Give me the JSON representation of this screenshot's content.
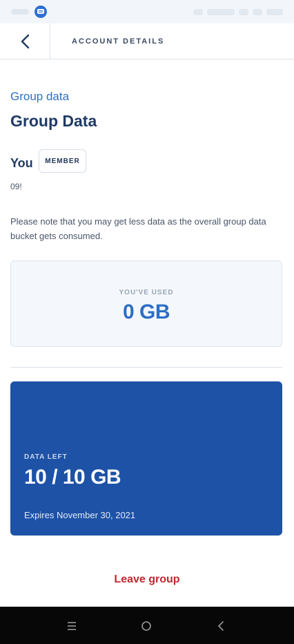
{
  "header": {
    "title": "ACCOUNT DETAILS"
  },
  "main": {
    "section_label": "Group data",
    "title": "Group Data",
    "you_label": "You",
    "member_badge": "MEMBER",
    "phone_number": "09!",
    "note": "Please note that you may get less data as the overall group data bucket gets consumed.",
    "used": {
      "label": "YOU'VE USED",
      "value": "0 GB"
    },
    "left": {
      "label": "DATA LEFT",
      "value": "10 / 10 GB",
      "expires": "Expires November 30, 2021"
    },
    "leave_group": "Leave group"
  },
  "colors": {
    "accent_blue": "#1d52a6",
    "link_blue": "#2f6fc3",
    "danger_red": "#c0272d"
  },
  "icons": {
    "back": "chevron-left-icon",
    "chat": "chat-icon",
    "nav_menu": "menu-icon",
    "nav_home": "home-icon",
    "nav_back": "back-icon"
  }
}
